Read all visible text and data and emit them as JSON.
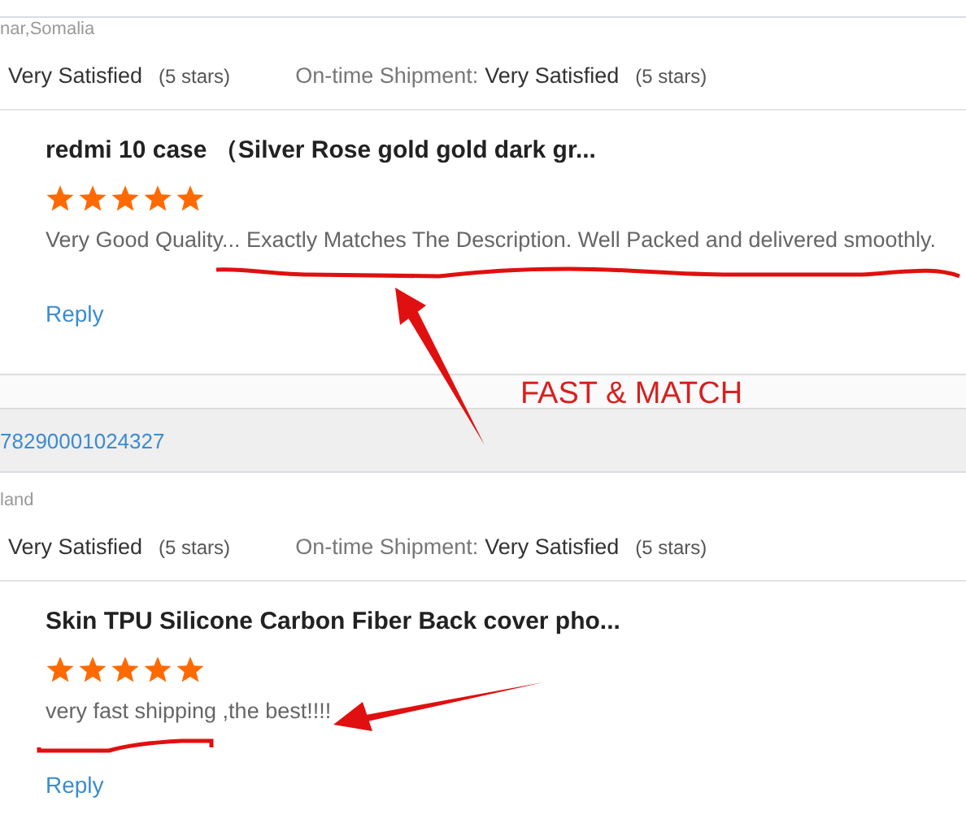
{
  "sections": [
    {
      "location": "nar,Somalia",
      "ratings": [
        {
          "value": "Very Satisfied",
          "note": "(5 stars)"
        },
        {
          "label": "On-time Shipment:",
          "value": "Very Satisfied",
          "note": "(5 stars)"
        }
      ],
      "product": "redmi 10 case （Silver Rose gold gold dark gr...",
      "stars": 5,
      "comment": "Very Good Quality... Exactly Matches The Description. Well Packed and delivered smoothly.",
      "reply": "Reply"
    },
    {
      "order_number": "78290001024327",
      "location": "land",
      "ratings": [
        {
          "value": "Very Satisfied",
          "note": "(5 stars)"
        },
        {
          "label": "On-time Shipment:",
          "value": "Very Satisfied",
          "note": "(5 stars)"
        }
      ],
      "product": "Skin TPU Silicone Carbon Fiber Back cover pho...",
      "stars": 5,
      "comment": "very fast shipping ,the best!!!!",
      "reply": "Reply"
    }
  ],
  "annotation": {
    "text": "FAST & MATCH"
  }
}
